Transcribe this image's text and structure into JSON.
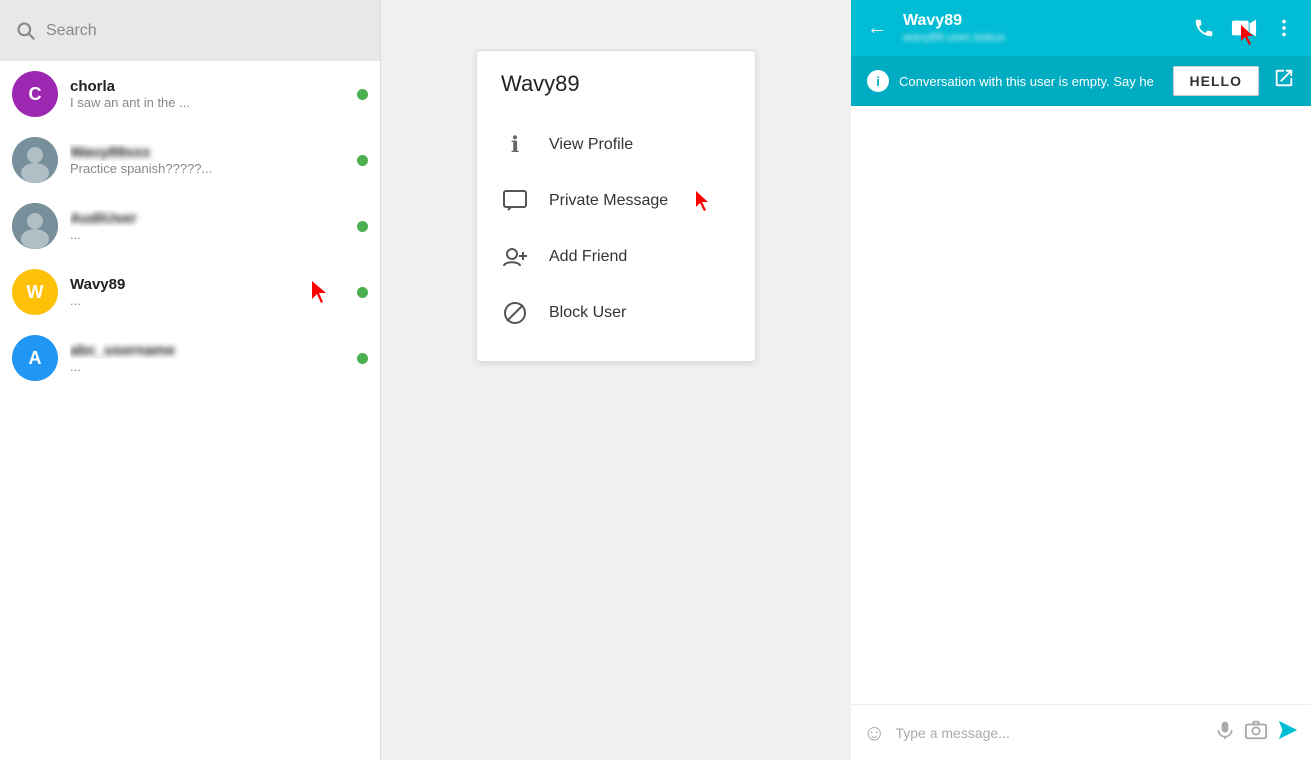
{
  "search": {
    "placeholder": "Search"
  },
  "contacts": [
    {
      "id": "chorla",
      "name": "chorla",
      "preview": "I saw an ant in the ...",
      "avatarColor": "#9c27b0",
      "avatarLabel": "C",
      "online": true,
      "hasImage": false
    },
    {
      "id": "wavy89-blurred",
      "name": "Wavy89-blurred",
      "preview": "Practice spanish?????...",
      "avatarColor": "#9e9e9e",
      "avatarLabel": "",
      "online": true,
      "hasImage": true,
      "blurred": true
    },
    {
      "id": "user3",
      "name": "user3-blurred",
      "preview": "...",
      "avatarColor": "#9e9e9e",
      "avatarLabel": "",
      "online": true,
      "hasImage": true,
      "blurred": true
    },
    {
      "id": "wavy89",
      "name": "Wavy89",
      "preview": "...",
      "avatarColor": "#ffc107",
      "avatarLabel": "W",
      "online": true,
      "hasImage": false,
      "hasCursor": true
    },
    {
      "id": "user-a",
      "name": "user-a-blurred",
      "preview": "...",
      "avatarColor": "#2196f3",
      "avatarLabel": "A",
      "online": true,
      "hasImage": false,
      "blurred": true
    }
  ],
  "contextMenu": {
    "title": "Wavy89",
    "items": [
      {
        "id": "view-profile",
        "label": "View Profile",
        "icon": "ℹ"
      },
      {
        "id": "private-message",
        "label": "Private Message",
        "icon": "💬",
        "hasCursor": true
      },
      {
        "id": "add-friend",
        "label": "Add Friend",
        "icon": "👤+"
      },
      {
        "id": "block-user",
        "label": "Block User",
        "icon": "⊘"
      }
    ]
  },
  "chat": {
    "headerName": "Wavy89",
    "headerStatus": "wavy89.user",
    "notificationText": "Conversation with this user is empty. Say he",
    "helloButton": "HELLO",
    "inputPlaceholder": "Type a message..."
  }
}
